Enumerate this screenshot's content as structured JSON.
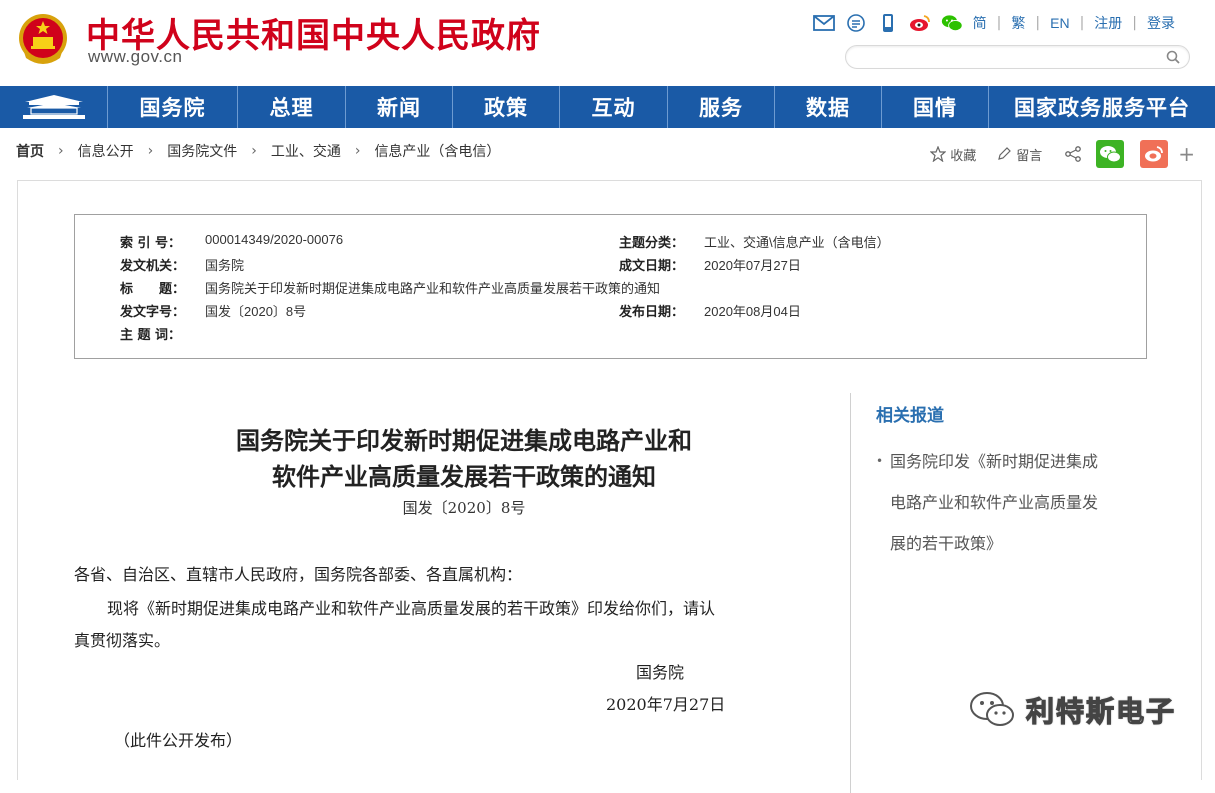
{
  "header": {
    "site_title": "中华人民共和国中央人民政府",
    "site_url": "www.gov.cn",
    "top_links": {
      "simplified": "简",
      "traditional": "繁",
      "english": "EN",
      "register": "注册",
      "login": "登录"
    },
    "search": {
      "placeholder": ""
    }
  },
  "nav": {
    "items": [
      "国务院",
      "总理",
      "新闻",
      "政策",
      "互动",
      "服务",
      "数据",
      "国情",
      "国家政务服务平台"
    ]
  },
  "breadcrumb": [
    "首页",
    "信息公开",
    "国务院文件",
    "工业、交通",
    "信息产业（含电信）"
  ],
  "tools": {
    "favorite": "收藏",
    "comment": "留言",
    "plus": "+"
  },
  "meta": {
    "index_no_label": "索 引 号：",
    "index_no": "000014349/2020-00076",
    "category_label": "主题分类：",
    "category": "工业、交通\\信息产业（含电信）",
    "issuer_label": "发文机关：",
    "issuer": "国务院",
    "written_date_label": "成文日期：",
    "written_date": "2020年07月27日",
    "title_label": "标　　题：",
    "title": "国务院关于印发新时期促进集成电路产业和软件产业高质量发展若干政策的通知",
    "doc_no_label": "发文字号：",
    "doc_no": "国发〔2020〕8号",
    "publish_date_label": "发布日期：",
    "publish_date": "2020年08月04日",
    "keywords_label": "主 题 词："
  },
  "article": {
    "title_line1": "国务院关于印发新时期促进集成电路产业和",
    "title_line2": "软件产业高质量发展若干政策的通知",
    "doc_no": "国发〔2020〕8号",
    "salutation": "各省、自治区、直辖市人民政府，国务院各部委、各直属机构：",
    "para1_line1": "现将《新时期促进集成电路产业和软件产业高质量发展的若干政策》印发给你们，请认",
    "para1_line2": "真贯彻落实。",
    "signer": "国务院",
    "sign_date": "2020年7月27日",
    "note": "（此件公开发布）"
  },
  "related": {
    "title": "相关报道",
    "link_line1": "国务院印发《新时期促进集成",
    "link_line2": "电路产业和软件产业高质量发",
    "link_line3": "展的若干政策》"
  },
  "watermark": {
    "text": "利特斯电子"
  },
  "colors": {
    "brand_red": "#d0021b",
    "nav_blue": "#1a5aa6",
    "link_blue": "#2a6fb0"
  }
}
